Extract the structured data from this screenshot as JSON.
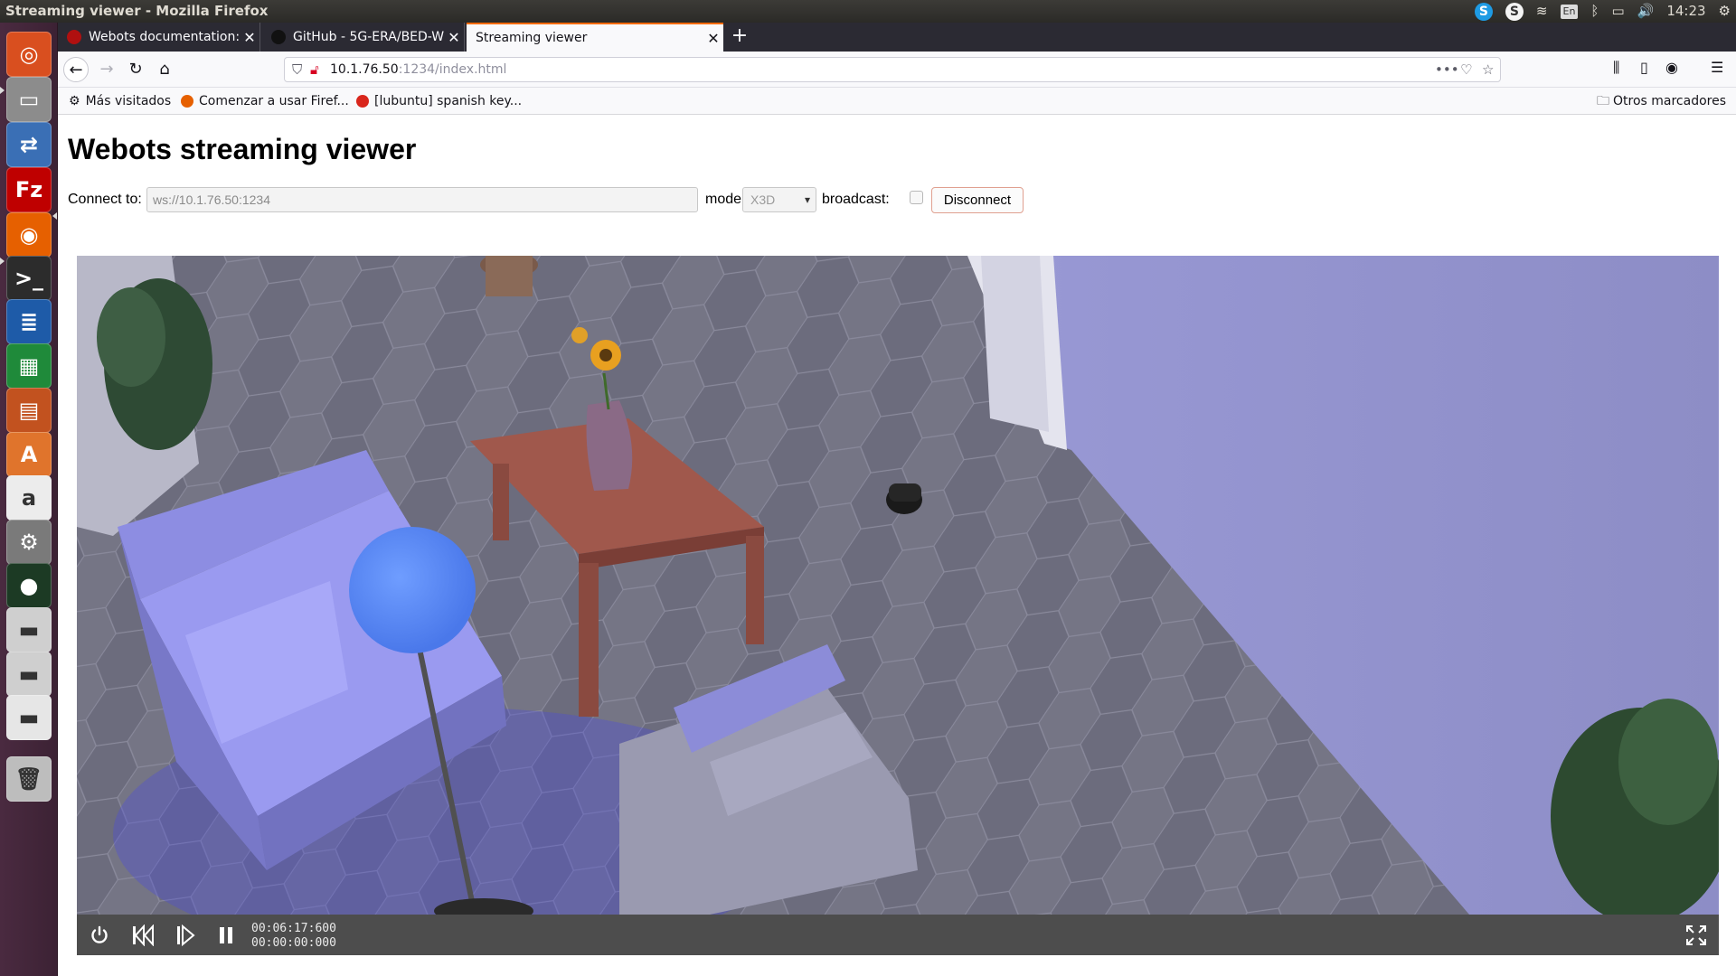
{
  "window": {
    "title": "Streaming viewer - Mozilla Firefox"
  },
  "system_tray": {
    "keyboard_layout": "En",
    "clock": "14:23"
  },
  "launcher": {
    "items": [
      {
        "name": "ubuntu-dash",
        "glyph": "◎",
        "color": "#d94f1f"
      },
      {
        "name": "file-manager",
        "glyph": "▭",
        "color": "#8c8c8c"
      },
      {
        "name": "remote-desktop",
        "glyph": "⇄",
        "color": "#3a6fb5"
      },
      {
        "name": "filezilla",
        "glyph": "Fz",
        "color": "#bf0000"
      },
      {
        "name": "firefox",
        "glyph": "◉",
        "color": "#e66000"
      },
      {
        "name": "terminal",
        "glyph": ">_",
        "color": "#2c2c2c"
      },
      {
        "name": "libreoffice-writer",
        "glyph": "≣",
        "color": "#1e5ba8"
      },
      {
        "name": "libreoffice-calc",
        "glyph": "▦",
        "color": "#1f8a3a"
      },
      {
        "name": "libreoffice-impress",
        "glyph": "▤",
        "color": "#c2521f"
      },
      {
        "name": "software-center",
        "glyph": "A",
        "color": "#e0742c"
      },
      {
        "name": "amazon",
        "glyph": "a",
        "color": "#ececec"
      },
      {
        "name": "system-settings",
        "glyph": "⚙",
        "color": "#7a7a7a"
      },
      {
        "name": "webcam",
        "glyph": "●",
        "color": "#1c3a24"
      },
      {
        "name": "drive-1",
        "glyph": "▬",
        "color": "#cfcfcf"
      },
      {
        "name": "drive-2",
        "glyph": "▬",
        "color": "#cfcfcf"
      },
      {
        "name": "drive-3",
        "glyph": "▬",
        "color": "#e6e6e6"
      },
      {
        "name": "trash",
        "glyph": "🗑",
        "color": "#bdbdbd"
      }
    ]
  },
  "browser": {
    "tabs": [
      {
        "label": "Webots documentation:",
        "active": false
      },
      {
        "label": "GitHub - 5G-ERA/BED-W",
        "active": false
      },
      {
        "label": "Streaming viewer",
        "active": true
      }
    ],
    "url_host": "10.1.76.50",
    "url_rest": ":1234/index.html",
    "bookmarks": [
      {
        "label": "Más visitados"
      },
      {
        "label": "Comenzar a usar Firef..."
      },
      {
        "label": "[lubuntu] spanish key..."
      }
    ],
    "other_bookmarks": "Otros marcadores"
  },
  "page": {
    "title": "Webots streaming viewer",
    "connect_label": "Connect to:",
    "connect_value": "ws://10.1.76.50:1234",
    "mode_label": "mode:",
    "mode_value": "X3D",
    "broadcast_label": "broadcast:",
    "broadcast_checked": false,
    "disconnect_label": "Disconnect"
  },
  "simulation_toolbar": {
    "simulation_time": "00:06:17:600",
    "real_time": "00:00:00:000"
  }
}
